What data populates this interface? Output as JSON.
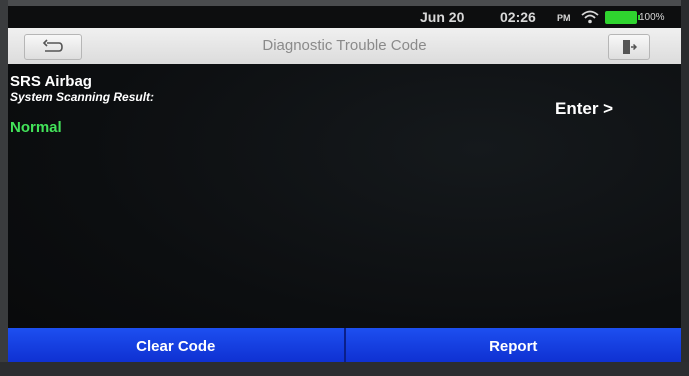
{
  "status_bar": {
    "date": "Jun 20",
    "time": "02:26",
    "ampm": "PM",
    "battery": "100%"
  },
  "header": {
    "title": "Diagnostic Trouble Code"
  },
  "system": {
    "name": "SRS Airbag",
    "result_label": "System Scanning Result:",
    "result_value": "Normal",
    "enter_label": "Enter >"
  },
  "footer": {
    "clear_label": "Clear Code",
    "report_label": "Report"
  },
  "colors": {
    "accent": "#1d4ff0",
    "status_normal": "#43e35a",
    "battery": "#2fd42f"
  }
}
